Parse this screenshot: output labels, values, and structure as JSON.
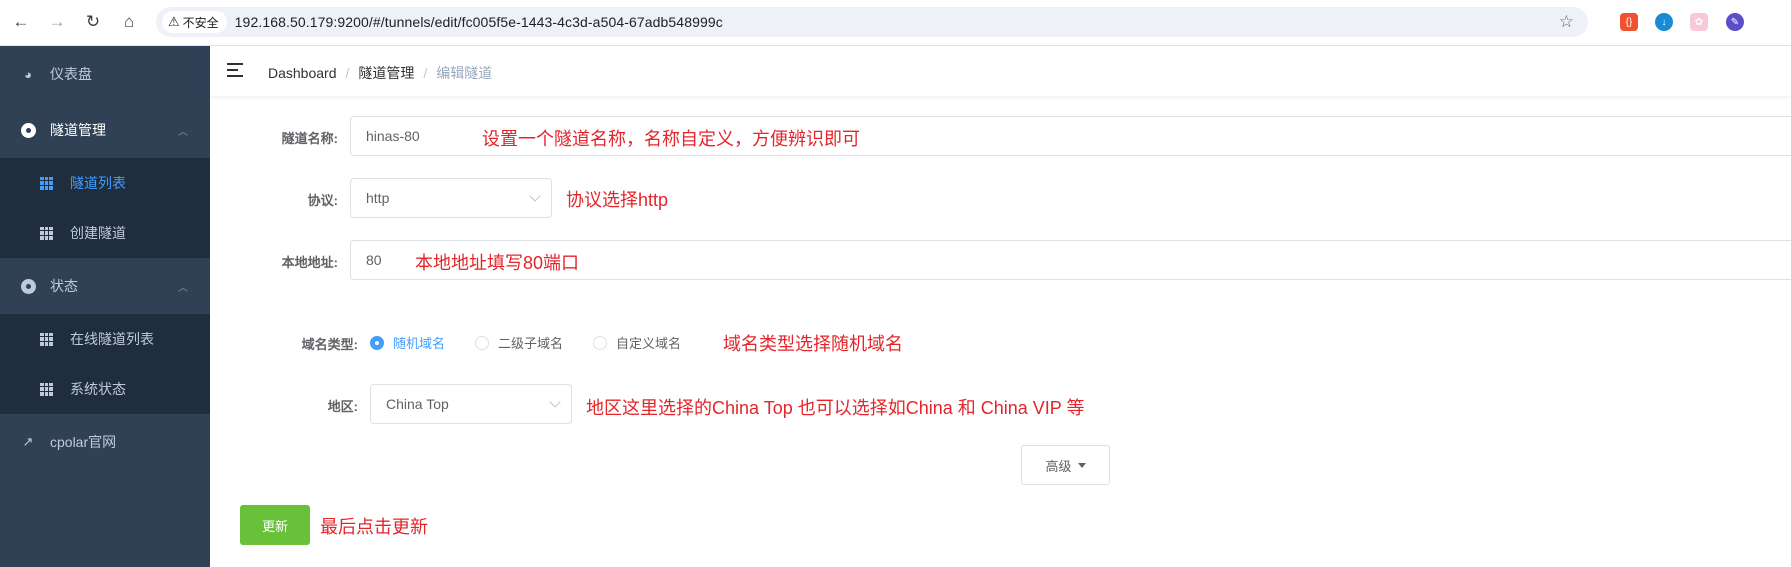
{
  "browser": {
    "security_label": "不安全",
    "url": "192.168.50.179:9200/#/tunnels/edit/fc005f5e-1443-4c3d-a504-67adb548999c"
  },
  "sidebar": {
    "items": [
      {
        "label": "仪表盘"
      },
      {
        "label": "隧道管理"
      },
      {
        "label": "隧道列表"
      },
      {
        "label": "创建隧道"
      },
      {
        "label": "状态"
      },
      {
        "label": "在线隧道列表"
      },
      {
        "label": "系统状态"
      },
      {
        "label": "cpolar官网"
      }
    ]
  },
  "breadcrumb": [
    "Dashboard",
    "隧道管理",
    "编辑隧道"
  ],
  "form": {
    "name_label": "隧道名称:",
    "name_value": "hinas-80",
    "protocol_label": "协议:",
    "protocol_value": "http",
    "local_label": "本地地址:",
    "local_value": "80",
    "domain_label": "域名类型:",
    "domain_options": [
      "随机域名",
      "二级子域名",
      "自定义域名"
    ],
    "domain_selected": "随机域名",
    "region_label": "地区:",
    "region_value": "China Top",
    "advanced_label": "高级",
    "update_label": "更新"
  },
  "annotations": {
    "name": "设置一个隧道名称，名称自定义，方便辨识即可",
    "protocol": "协议选择http",
    "local": "本地地址填写80端口",
    "domain": "域名类型选择随机域名",
    "region": "地区这里选择的China Top  也可以选择如China 和 China VIP 等",
    "update": "最后点击更新"
  },
  "colors": {
    "sidebar_bg": "#304156",
    "submenu_bg": "#1f2d3d",
    "active": "#409eff",
    "primary_button": "#67c23a",
    "annotation": "#e4252a"
  }
}
